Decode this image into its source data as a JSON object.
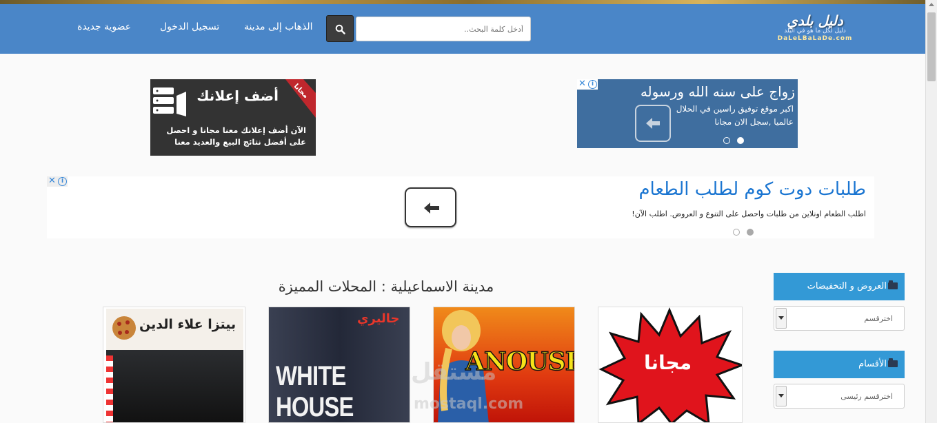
{
  "header": {
    "logo": {
      "line1": "دليل بلدي",
      "line2": "دليل لكل ما هو في البلد",
      "line3": "DaLeLBaLaDe.com"
    },
    "search": {
      "placeholder": "أدخل كلمة البحث.."
    },
    "nav": [
      {
        "label": "الذهاب إلى مدينة"
      },
      {
        "label": "تسجيل الدخول"
      },
      {
        "label": "عضوية جديدة"
      }
    ]
  },
  "ads": {
    "free_ad": {
      "ribbon": "مجانا",
      "title": "أضف إعلانك",
      "body": "الآن أضف إعلانك معنا مجانا و احصل على أفضل نتائج البيع والعديد معنا"
    },
    "marriage_ad": {
      "title": "زواج على سنه الله ورسوله",
      "body": "اكبر موقع توفيق راسين في الحلال عالميا ,سجل الان مجانا"
    },
    "talabat_ad": {
      "title": "طلبات دوت كوم لطلب الطعام",
      "body": "اطلب الطعام اونلاين من طلبات واحصل على التنوع و العروض. اطلب الآن!"
    }
  },
  "main": {
    "section_title": "مدينة الاسماعيلية : المحلات المميزة",
    "cards": [
      {
        "label": "مجانا"
      },
      {
        "label": "ANOUSH"
      },
      {
        "top_label": "جاليري",
        "label": "WHITE HOUSE"
      },
      {
        "label": "بيتزا علاء الدين"
      }
    ],
    "watermark": {
      "text1": "مستقل",
      "text2": "mostaql.com"
    }
  },
  "sidebar": {
    "offers": {
      "title": "العروض و التخفيضات",
      "select_value": "اخترقسم"
    },
    "categories": {
      "title": "الأقسام",
      "select_value": "اخترقسم رئيسى"
    }
  },
  "colors": {
    "navbar": "#4a86c8",
    "panel": "#3399d6",
    "talabat_title": "#1a75d1"
  }
}
